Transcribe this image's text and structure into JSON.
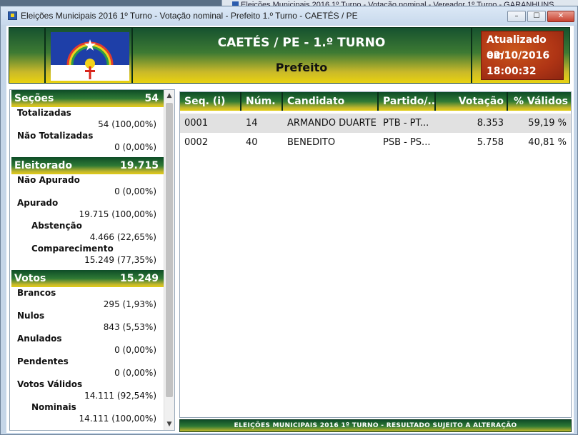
{
  "background_window": {
    "title": "Eleições Municipais 2016 1º Turno - Votação nominal - Vereador 1º Turno - GARANHUNS",
    "side_fragments": [
      "F",
      "E",
      "U",
      "l",
      "J",
      "A",
      "S"
    ]
  },
  "window": {
    "title": "Eleições Municipais 2016 1º Turno - Votação nominal - Prefeito 1.º Turno - CAETÉS / PE",
    "buttons": {
      "minimize": "–",
      "maximize": "☐",
      "close": "✕"
    }
  },
  "header": {
    "title": "CAETÉS / PE - 1.º TURNO",
    "subtitle": "Prefeito",
    "updated_label": "Atualizado em",
    "updated_date": "02/10/2016",
    "updated_time": "18:00:32"
  },
  "left_panel": {
    "secoes": {
      "label": "Seções",
      "total": "54",
      "rows": [
        {
          "label": "Totalizadas",
          "value": "54 (100,00%)"
        },
        {
          "label": "Não Totalizadas",
          "value": "0 (0,00%)"
        }
      ]
    },
    "eleitorado": {
      "label": "Eleitorado",
      "total": "19.715",
      "rows": [
        {
          "label": "Não Apurado",
          "value": "0 (0,00%)"
        },
        {
          "label": "Apurado",
          "value": "19.715 (100,00%)"
        },
        {
          "label": "Abstenção",
          "value": "4.466 (22,65%)"
        },
        {
          "label": "Comparecimento",
          "value": "15.249 (77,35%)"
        }
      ]
    },
    "votos": {
      "label": "Votos",
      "total": "15.249",
      "rows": [
        {
          "label": "Brancos",
          "value": "295 (1,93%)"
        },
        {
          "label": "Nulos",
          "value": "843 (5,53%)"
        },
        {
          "label": "Anulados",
          "value": "0 (0,00%)"
        },
        {
          "label": "Pendentes",
          "value": "0 (0,00%)"
        },
        {
          "label": "Votos Válidos",
          "value": "14.111 (92,54%)"
        },
        {
          "label": "Nominais",
          "value": "14.111 (100,00%)"
        }
      ]
    },
    "scroll_up": "▲",
    "scroll_down": "▼"
  },
  "table": {
    "columns": [
      "Seq.  (i)",
      "Núm.",
      "Candidato",
      "Partido/...",
      "Votação",
      "% Válidos"
    ],
    "rows": [
      {
        "seq": "0001",
        "num": "14",
        "candidate": "ARMANDO DUARTE",
        "party": "PTB - PT...",
        "votes": "8.353",
        "pct": "59,19 %"
      },
      {
        "seq": "0002",
        "num": "40",
        "candidate": "BENEDITO",
        "party": "PSB - PS...",
        "votes": "5.758",
        "pct": "40,81 %"
      }
    ]
  },
  "footer": "ELEIÇÕES MUNICIPAIS 2016 1º TURNO - RESULTADO SUJEITO A ALTERAÇÃO",
  "colors": {
    "header_green": "#16522f",
    "header_yellow": "#e9d20f",
    "updated_red": "#b03515",
    "selected_row": "#e1e1e1"
  }
}
